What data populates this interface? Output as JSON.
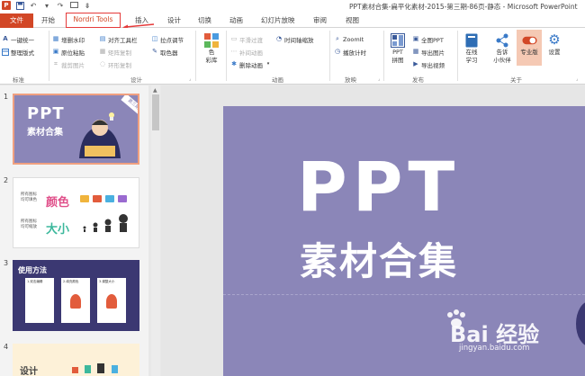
{
  "window": {
    "title": "PPT素材合集-扁平化素材-2015-第三期-86页-静态 - Microsoft PowerPoint"
  },
  "quick_access": {
    "app_badge": "P"
  },
  "tabs": {
    "file": "文件",
    "items": [
      "开始",
      "Nordri Tools",
      "插入",
      "设计",
      "切换",
      "动画",
      "幻灯片放映",
      "审阅",
      "视图"
    ],
    "active": "Nordri Tools"
  },
  "ribbon": {
    "groups": {
      "standard": {
        "label": "标准",
        "buttons": [
          "一键统一",
          "整理版式"
        ]
      },
      "design": {
        "label": "设计",
        "buttons": [
          "增删水印",
          "对齐工具栏",
          "拉点调节",
          "原位粘贴",
          "矩阵复制",
          "取色器",
          "裁剪图片",
          "环形复制"
        ]
      },
      "color": {
        "big_button": "色\n彩库"
      },
      "animation": {
        "label": "动画",
        "buttons": [
          "平滑过渡",
          "时间轴缩放",
          "补间动画",
          "删除动画"
        ]
      },
      "play": {
        "label": "放映",
        "buttons": [
          "ZoomIt",
          "播放计时"
        ]
      },
      "publish": {
        "label": "发布",
        "big_button": "PPT\n拼图",
        "buttons": [
          "全图PPT",
          "导出图片",
          "导出视频"
        ]
      },
      "about": {
        "label": "关于",
        "big_buttons": [
          "在线\n学习",
          "告诉\n小伙伴",
          "专业版",
          "设置"
        ]
      }
    }
  },
  "slides_panel": {
    "slides": [
      {
        "number": "1",
        "title": "PPT",
        "subtitle": "素材合集",
        "badge": "第三期"
      },
      {
        "number": "2",
        "rows": [
          {
            "label_lines": [
              "所有图标",
              "均可填色"
            ],
            "word": "颜色"
          },
          {
            "label_lines": [
              "所有图标",
              "均可缩放"
            ],
            "word": "大小"
          }
        ]
      },
      {
        "number": "3",
        "title": "使用方法",
        "captions": [
          "1.双击编辑",
          "2.填充颜色",
          "3.调整大小"
        ]
      },
      {
        "number": "4",
        "title": "设计"
      }
    ]
  },
  "main_slide": {
    "title": "PPT",
    "subtitle": "素材合集"
  },
  "watermark": {
    "main": "Bai 经验",
    "sub": "jingyan.baidu.com"
  },
  "colors": {
    "accent": "#d24726",
    "slide_bg": "#8b86b8",
    "active_tab_border": "#e53a3a",
    "thumb_selected_border": "#f0a080"
  }
}
